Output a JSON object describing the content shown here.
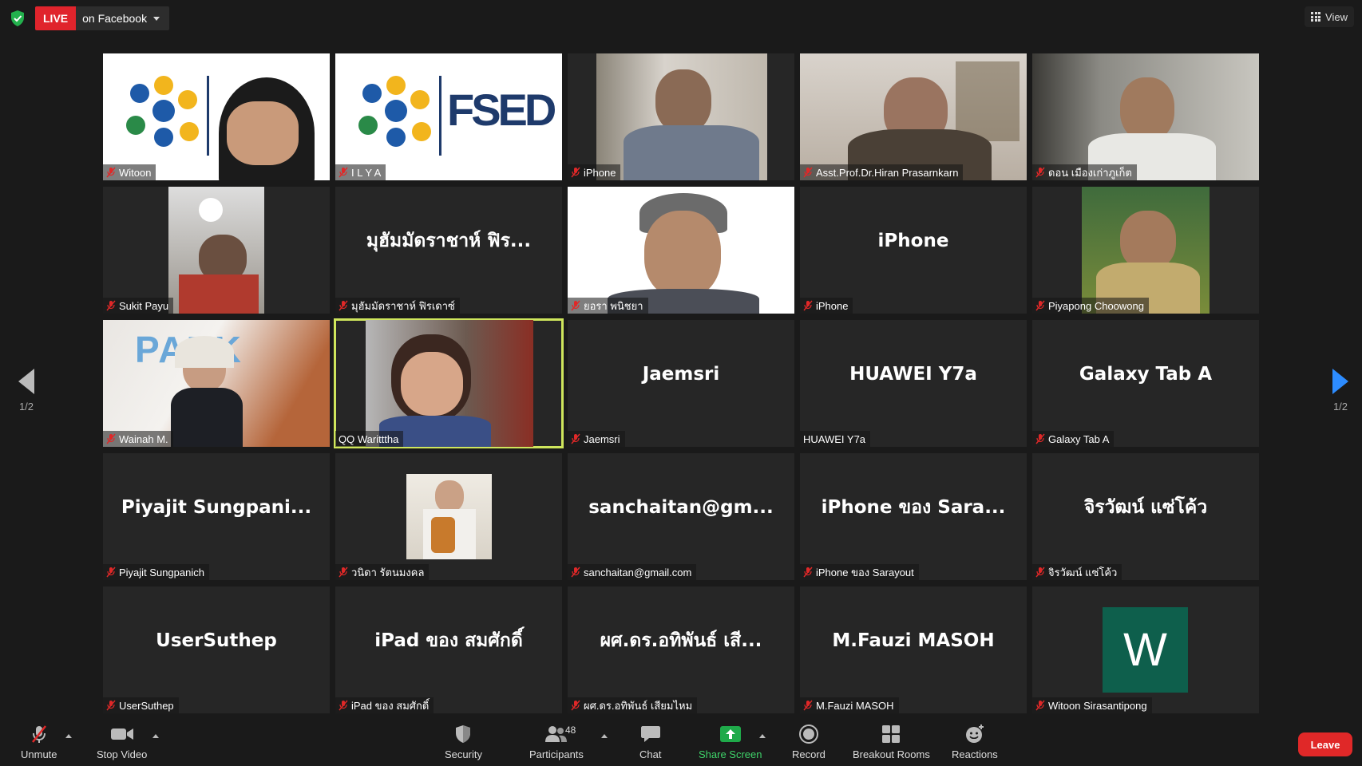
{
  "top_bar": {
    "live_label": "LIVE",
    "live_destination": "on Facebook",
    "view_label": "View"
  },
  "paging": {
    "left_label": "1/2",
    "right_label": "1/2"
  },
  "tiles": [
    {
      "name_label": "Witoon",
      "muted": true,
      "video": "logo-person"
    },
    {
      "name_label": "I L Y A",
      "muted": true,
      "video": "logo"
    },
    {
      "name_label": "iPhone",
      "muted": true,
      "video": "person"
    },
    {
      "name_label": "Asst.Prof.Dr.Hiran Prasarnkarn",
      "muted": true,
      "video": "person"
    },
    {
      "name_label": "ดอน เมืองเก่าภูเก็ต",
      "muted": true,
      "video": "person"
    },
    {
      "name_label": "Sukit Payu",
      "muted": true,
      "video": "person"
    },
    {
      "display_name": "มุฮัมมัดราชาห์ ฟิร...",
      "name_label": "มุฮัมมัดราชาห์ ฟิรเดาซ์",
      "muted": true
    },
    {
      "name_label": "ยอรา พนิชยา",
      "muted": true,
      "video": "person"
    },
    {
      "display_name": "iPhone",
      "name_label": "iPhone",
      "muted": true
    },
    {
      "name_label": "Piyapong Choowong",
      "muted": true,
      "video": "person"
    },
    {
      "name_label": "Wainah  M.",
      "muted": true,
      "video": "person"
    },
    {
      "name_label": "QQ Waritttha",
      "muted": false,
      "active": true,
      "video": "person"
    },
    {
      "display_name": "Jaemsri",
      "name_label": "Jaemsri",
      "muted": true
    },
    {
      "display_name": "HUAWEI Y7a",
      "name_label": "HUAWEI Y7a",
      "muted": false
    },
    {
      "display_name": "Galaxy Tab A",
      "name_label": "Galaxy Tab A",
      "muted": true
    },
    {
      "display_name": "Piyajit  Sungpani...",
      "name_label": "Piyajit Sungpanich",
      "muted": true
    },
    {
      "name_label": "วนิดา รัตนมงคล",
      "muted": true,
      "video": "person"
    },
    {
      "display_name": "sanchaitan@gm...",
      "name_label": "sanchaitan@gmail.com",
      "muted": true
    },
    {
      "display_name": "iPhone ของ Sara...",
      "name_label": "iPhone ของ Sarayout",
      "muted": true
    },
    {
      "display_name": "จิรวัฒน์ แซ่โค้ว",
      "name_label": "จิรวัฒน์ แซ่โค้ว",
      "muted": true
    },
    {
      "display_name": "UserSuthep",
      "name_label": "UserSuthep",
      "muted": true
    },
    {
      "display_name": "iPad ของ สมศักดิ์",
      "name_label": "iPad ของ สมศักดิ์",
      "muted": true
    },
    {
      "display_name": "ผศ.ดร.อทิพันธ์ เสี...",
      "name_label": "ผศ.ดร.อทิพันธ์ เสียมไหม",
      "muted": true
    },
    {
      "display_name": "M.Fauzi MASOH",
      "name_label": "M.Fauzi MASOH",
      "muted": true
    },
    {
      "avatar_letter": "W",
      "name_label": "Witoon Sirasantipong",
      "muted": true
    }
  ],
  "toolbar": {
    "unmute": "Unmute",
    "stop_video": "Stop Video",
    "security": "Security",
    "participants": "Participants",
    "participants_count": "48",
    "chat": "Chat",
    "share_screen": "Share Screen",
    "record": "Record",
    "breakout_rooms": "Breakout Rooms",
    "reactions": "Reactions",
    "leave": "Leave"
  },
  "colors": {
    "live_red": "#e0242c",
    "active_speaker": "#cfe65c",
    "share_green": "#3fd46a",
    "leave_red": "#e02828",
    "avatar_green": "#0e5f4c",
    "mute_red": "#e02828"
  }
}
